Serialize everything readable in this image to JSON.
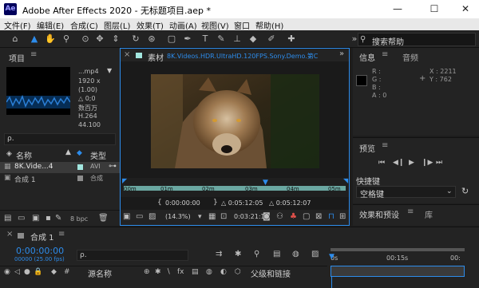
{
  "window": {
    "title": "Adobe After Effects 2020 - 无标题项目.aep *",
    "app_icon": "Ae",
    "minimize": "—",
    "maximize": "☐",
    "close": "✕"
  },
  "menu": [
    "文件(F)",
    "编辑(E)",
    "合成(C)",
    "图层(L)",
    "效果(T)",
    "动画(A)",
    "视图(V)",
    "窗口",
    "帮助(H)"
  ],
  "toolbar": {
    "search_placeholder": "搜索帮助"
  },
  "project": {
    "title": "项目",
    "file_name": "...mp4",
    "dims": "1920 x",
    "aspect": "(1.00)",
    "duration": "△ 0;0",
    "count": "数百万",
    "codec": "H.264",
    "audio": "44.100",
    "search_icon": "ρ.",
    "col_name": "名称",
    "col_type": "类型",
    "rows": [
      {
        "name": "8K.Vide...4",
        "type": "AVI"
      },
      {
        "name": "合成 1",
        "type": "合成"
      }
    ],
    "bpc": "8 bpc"
  },
  "viewer": {
    "tab_label": "素材",
    "tab_file": "8K.Videos.HDR.UltraHD.120FPS.Sony.Demo.第C",
    "ruler": [
      "00m",
      "01m",
      "02m",
      "03m",
      "04m",
      "05m"
    ],
    "time_in": "0:00:00:00",
    "time_mid": "△ 0:05:12:05",
    "time_out": "△ 0:05:12:07",
    "zoom": "(14.3%)",
    "current_time": "0:03:21:19"
  },
  "info": {
    "tab_info": "信息",
    "tab_audio": "音频",
    "r": "R :",
    "g": "G :",
    "b": "B :",
    "a": "A : 0",
    "x": "X : 2211",
    "y": "Y : 762"
  },
  "preview": {
    "title": "预览",
    "shortcut_label": "快捷键",
    "shortcut_value": "空格键"
  },
  "effects": {
    "tab_effects": "效果和预设",
    "tab_library": "库"
  },
  "timeline": {
    "comp_tab": "合成 1",
    "timecode": "0:00:00:00",
    "fps": "00000 (25.00 fps)",
    "search": "ρ.",
    "col_source": "源名称",
    "col_parent": "父级和链接",
    "ruler": [
      "0s",
      "00:15s",
      "00:"
    ]
  },
  "colors": {
    "accent": "#2d8ceb",
    "titlebar": "#ffffff",
    "panel": "#232323",
    "teal_bar": "#6aa7a1"
  }
}
